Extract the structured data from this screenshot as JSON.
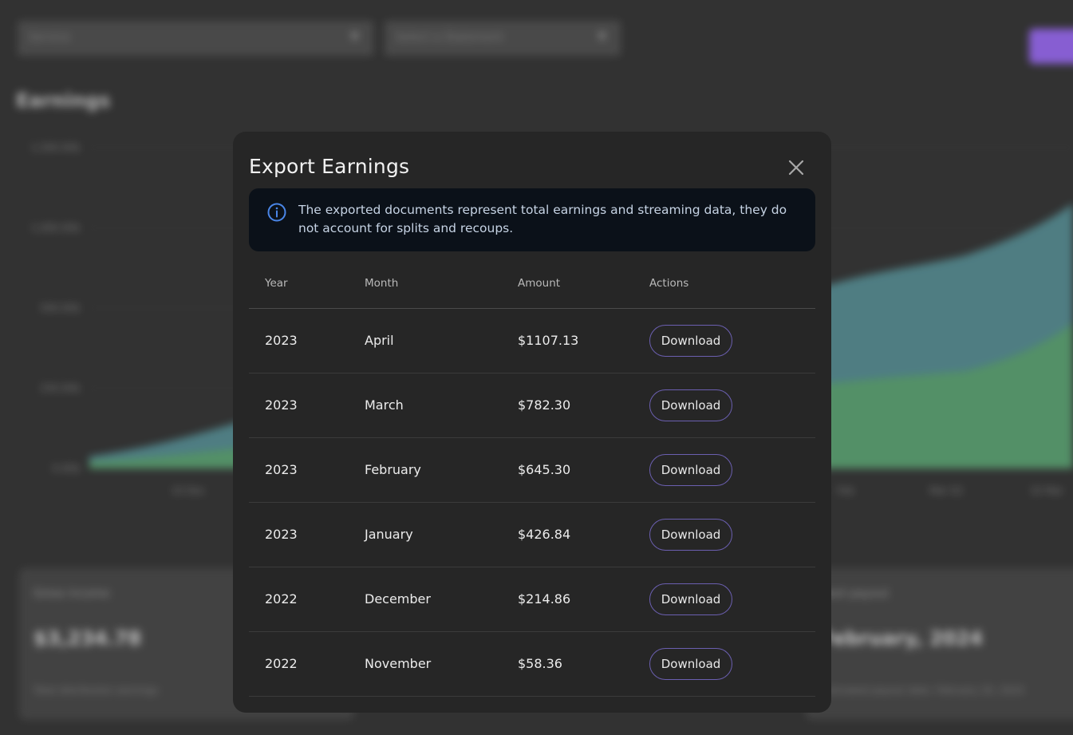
{
  "background": {
    "filter_select": {
      "value": "Service"
    },
    "release_select": {
      "placeholder": "Select a Statement"
    },
    "section_title": "Earnings",
    "chart_data": {
      "type": "area",
      "y_tick_labels": [
        "1,500.00$",
        "1,000.00$",
        "500.00$",
        "250.00$",
        "0.00$"
      ],
      "x_tick_labels": [
        "10 Dec",
        "Feb",
        "Mar 02",
        "10 Mar"
      ],
      "series": [
        {
          "color": "#5a8f95"
        },
        {
          "color": "#5fa476"
        }
      ]
    },
    "cards": [
      {
        "label": "Gross income",
        "value": "$3,234.78",
        "sub": "Total distribution earnings"
      },
      {
        "label": "Next payout",
        "value": "February, 2024",
        "sub": "Estimated payout date: February 20, 2024"
      }
    ]
  },
  "modal": {
    "title": "Export Earnings",
    "info_text": "The exported documents represent total earnings and streaming data, they do not account for splits and recoups.",
    "columns": [
      "Year",
      "Month",
      "Amount",
      "Actions"
    ],
    "rows": [
      {
        "year": "2023",
        "month": "April",
        "amount": "$1107.13",
        "action": "Download"
      },
      {
        "year": "2023",
        "month": "March",
        "amount": "$782.30",
        "action": "Download"
      },
      {
        "year": "2023",
        "month": "February",
        "amount": "$645.30",
        "action": "Download"
      },
      {
        "year": "2023",
        "month": "January",
        "amount": "$426.84",
        "action": "Download"
      },
      {
        "year": "2022",
        "month": "December",
        "amount": "$214.86",
        "action": "Download"
      },
      {
        "year": "2022",
        "month": "November",
        "amount": "$58.36",
        "action": "Download"
      }
    ]
  },
  "colors": {
    "accent_border": "#6b5fb0",
    "info_icon": "#4a86e8",
    "info_background": "#0b1119"
  }
}
